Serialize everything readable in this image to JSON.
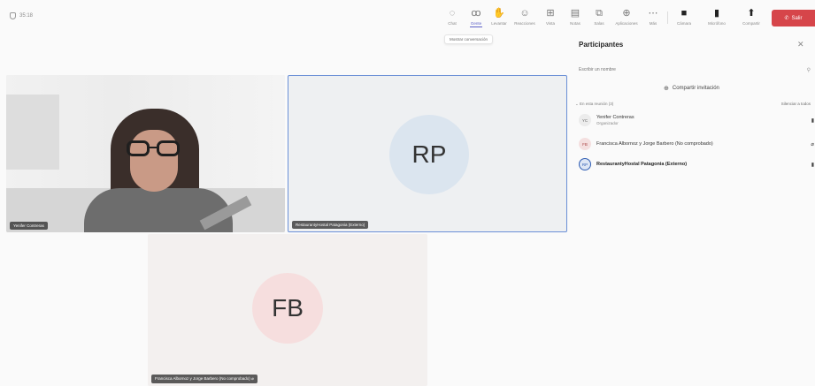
{
  "meeting": {
    "timer": "35:18"
  },
  "toolbar": {
    "items": [
      {
        "label": "Chat",
        "icon": "chat-icon",
        "glyph": "◌"
      },
      {
        "label": "Gente",
        "icon": "people-icon",
        "glyph": "ꝏ"
      },
      {
        "label": "Levantar",
        "icon": "raise-hand-icon",
        "glyph": "✋"
      },
      {
        "label": "Reacciones",
        "icon": "reactions-icon",
        "glyph": "☺"
      },
      {
        "label": "Vista",
        "icon": "view-icon",
        "glyph": "⊞"
      },
      {
        "label": "Notas",
        "icon": "notes-icon",
        "glyph": "▤"
      },
      {
        "label": "Salas",
        "icon": "rooms-icon",
        "glyph": "⧉"
      },
      {
        "label": "Aplicaciones",
        "icon": "apps-icon",
        "glyph": "⊕"
      },
      {
        "label": "Más",
        "icon": "more-icon",
        "glyph": "⋯"
      },
      {
        "label": "Cámara",
        "icon": "camera-icon",
        "glyph": "■"
      },
      {
        "label": "Micrófono",
        "icon": "microphone-icon",
        "glyph": "▮"
      },
      {
        "label": "Compartir",
        "icon": "share-screen-icon",
        "glyph": "⬆"
      }
    ],
    "hangup_label": "Salir",
    "tooltip": "Mostrar conversación"
  },
  "tiles": {
    "video_name": "Yenifer Contreras",
    "rp_initials": "RP",
    "rp_name": "RestaurantyHostal Patagonia (Externo)",
    "fb_initials": "FB",
    "fb_name": "Francisca Albornoz y Jorge Barbero (No comprobado)"
  },
  "panel": {
    "title": "Participantes",
    "search_placeholder": "Escribir un nombre",
    "share_invite": "Compartir invitación",
    "section_label": "En esta reunión (3)",
    "mute_all": "Silenciar a todos",
    "participants": [
      {
        "initials": "YC",
        "name": "Yenifer Contreras",
        "role": "Organizador"
      },
      {
        "initials": "FB",
        "name": "Francisca Albornoz y Jorge Barbero (No comprobado)",
        "role": ""
      },
      {
        "initials": "RP",
        "name": "RestaurantyHostal Patagonia (Externo)",
        "role": ""
      }
    ]
  },
  "colors": {
    "accent": "#5b5fc7",
    "hangup": "#d6454a",
    "selected_tile_border": "#6a8fd6"
  }
}
